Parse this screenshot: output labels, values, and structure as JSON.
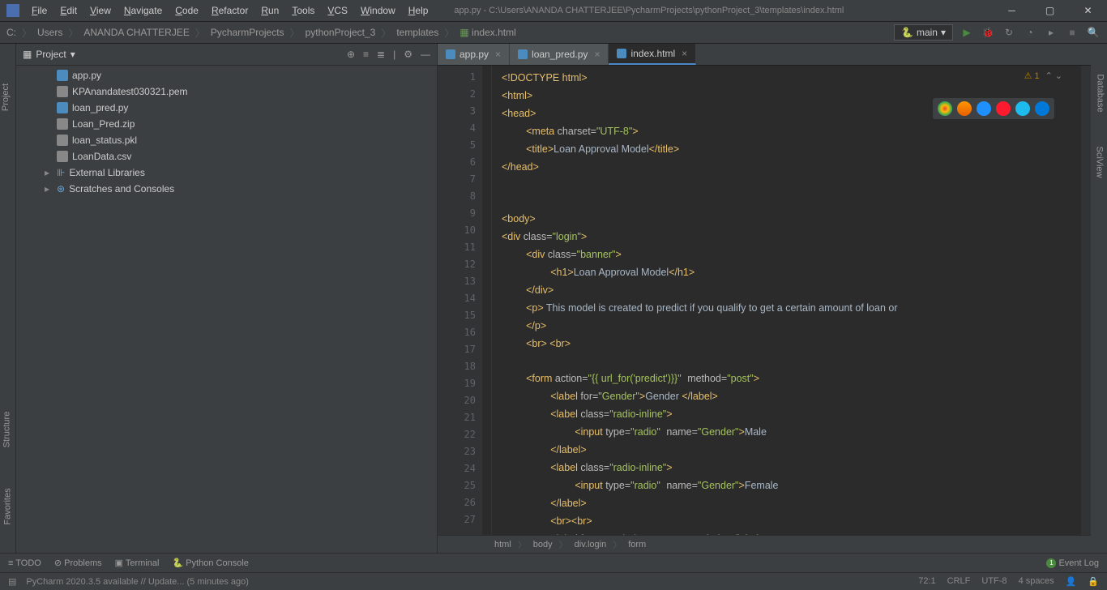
{
  "window": {
    "title": "app.py - C:\\Users\\ANANDA CHATTERJEE\\PycharmProjects\\pythonProject_3\\templates\\index.html"
  },
  "menu": [
    "File",
    "Edit",
    "View",
    "Navigate",
    "Code",
    "Refactor",
    "Run",
    "Tools",
    "VCS",
    "Window",
    "Help"
  ],
  "breadcrumb": [
    "C:",
    "Users",
    "ANANDA CHATTERJEE",
    "PycharmProjects",
    "pythonProject_3",
    "templates",
    "index.html"
  ],
  "runconfig": "main",
  "project": {
    "title": "Project",
    "items": [
      {
        "name": "app.py",
        "icon": "py"
      },
      {
        "name": "KPAnandatest030321.pem",
        "icon": "file"
      },
      {
        "name": "loan_pred.py",
        "icon": "py"
      },
      {
        "name": "Loan_Pred.zip",
        "icon": "zip"
      },
      {
        "name": "loan_status.pkl",
        "icon": "file"
      },
      {
        "name": "LoanData.csv",
        "icon": "csv"
      }
    ],
    "libs": [
      "External Libraries",
      "Scratches and Consoles"
    ]
  },
  "tabs": [
    {
      "label": "app.py",
      "active": false
    },
    {
      "label": "loan_pred.py",
      "active": false
    },
    {
      "label": "index.html",
      "active": true
    }
  ],
  "code_lines": [
    {
      "n": 1,
      "indent": 0,
      "html": "<span class='doctype'>&lt;!DOCTYPE html&gt;</span>"
    },
    {
      "n": 2,
      "indent": 0,
      "html": "<span class='tag'>&lt;html&gt;</span>"
    },
    {
      "n": 3,
      "indent": 0,
      "html": "<span class='tag'>&lt;head&gt;</span>"
    },
    {
      "n": 4,
      "indent": 1,
      "html": "<span class='tag'>&lt;meta </span><span class='attr'>charset=</span><span class='str'>\"UTF-8\"</span><span class='tag'>&gt;</span>"
    },
    {
      "n": 5,
      "indent": 1,
      "html": "<span class='tag'>&lt;title&gt;</span><span class='txt'>Loan Approval Model</span><span class='tag'>&lt;/title&gt;</span>"
    },
    {
      "n": 6,
      "indent": 0,
      "html": "<span class='tag'>&lt;/head&gt;</span>"
    },
    {
      "n": 7,
      "indent": 0,
      "html": ""
    },
    {
      "n": 8,
      "indent": 0,
      "html": ""
    },
    {
      "n": 9,
      "indent": 0,
      "html": "<span class='tag'>&lt;body&gt;</span>"
    },
    {
      "n": 10,
      "indent": 0,
      "html": "<span class='tag'>&lt;div </span><span class='attr'>class=</span><span class='str'>\"login\"</span><span class='tag'>&gt;</span>"
    },
    {
      "n": 11,
      "indent": 1,
      "html": "<span class='tag'>&lt;div </span><span class='attr'>class=</span><span class='str'>\"banner\"</span><span class='tag'>&gt;</span>"
    },
    {
      "n": 12,
      "indent": 2,
      "html": "<span class='tag'>&lt;h1&gt;</span><span class='txt'>Loan Approval Model</span><span class='tag'>&lt;/h1&gt;</span>"
    },
    {
      "n": 13,
      "indent": 1,
      "html": "<span class='tag'>&lt;/div&gt;</span>"
    },
    {
      "n": 14,
      "indent": 1,
      "html": "<span class='tag'>&lt;p&gt;</span><span class='txt'> This model is created to predict if you qualify to get a certain amount of loan or</span>"
    },
    {
      "n": 15,
      "indent": 1,
      "html": "<span class='tag'>&lt;/p&gt;</span>"
    },
    {
      "n": 16,
      "indent": 1,
      "html": "<span class='tag'>&lt;br&gt; &lt;br&gt;</span>"
    },
    {
      "n": 17,
      "indent": 0,
      "html": ""
    },
    {
      "n": 18,
      "indent": 1,
      "html": "<span class='tag'>&lt;form </span><span class='attr'>action=</span><span class='str'>\"{{ url_for('predict')}}\"</span> <span class='attr'>method=</span><span class='str'>\"post\"</span><span class='tag'>&gt;</span>"
    },
    {
      "n": 19,
      "indent": 2,
      "html": "<span class='tag'>&lt;label </span><span class='attr'>for=</span><span class='str'>\"Gender\"</span><span class='tag'>&gt;</span><span class='txt'>Gender </span><span class='tag'>&lt;/label&gt;</span>"
    },
    {
      "n": 20,
      "indent": 2,
      "html": "<span class='tag'>&lt;label </span><span class='attr'>class=</span><span class='str'>\"radio-inline\"</span><span class='tag'>&gt;</span>"
    },
    {
      "n": 21,
      "indent": 3,
      "html": "<span class='tag'>&lt;input </span><span class='attr'>type=</span><span class='str'>\"radio\"</span> <span class='attr'>name=</span><span class='str'>\"Gender\"</span><span class='tag'>&gt;</span><span class='txt'>Male</span>"
    },
    {
      "n": 22,
      "indent": 2,
      "html": "<span class='tag'>&lt;/label&gt;</span>"
    },
    {
      "n": 23,
      "indent": 2,
      "html": "<span class='tag'>&lt;label </span><span class='attr'>class=</span><span class='str'>\"radio-inline\"</span><span class='tag'>&gt;</span>"
    },
    {
      "n": 24,
      "indent": 3,
      "html": "<span class='tag'>&lt;input </span><span class='attr'>type=</span><span class='str'>\"radio\"</span> <span class='attr'>name=</span><span class='str'>\"Gender\"</span><span class='tag'>&gt;</span><span class='txt'>Female</span>"
    },
    {
      "n": 25,
      "indent": 2,
      "html": "<span class='tag'>&lt;/label&gt;</span>"
    },
    {
      "n": 26,
      "indent": 2,
      "html": "<span class='tag'>&lt;br&gt;&lt;br&gt;</span>"
    },
    {
      "n": 27,
      "indent": 2,
      "html": "<span class='tag'>&lt;label </span><span class='attr'>for=</span><span class='str'>\"Married\"</span><span class='tag'>&gt;</span><span class='txt'> Are you married? </span><span class='tag'>&lt;/label&gt;</span>"
    }
  ],
  "warn_count": "1",
  "editor_bc": [
    "html",
    "body",
    "div.login",
    "form"
  ],
  "bottom": {
    "items": [
      "TODO",
      "Problems",
      "Terminal",
      "Python Console"
    ],
    "event": "Event Log",
    "badge": "1"
  },
  "status": {
    "msg": "PyCharm 2020.3.5 available // Update... (5 minutes ago)",
    "pos": "72:1",
    "le": "CRLF",
    "enc": "UTF-8",
    "indent": "4 spaces"
  },
  "left_tools": [
    "Project",
    "Structure",
    "Favorites"
  ],
  "right_tools": [
    "Database",
    "SciView"
  ]
}
